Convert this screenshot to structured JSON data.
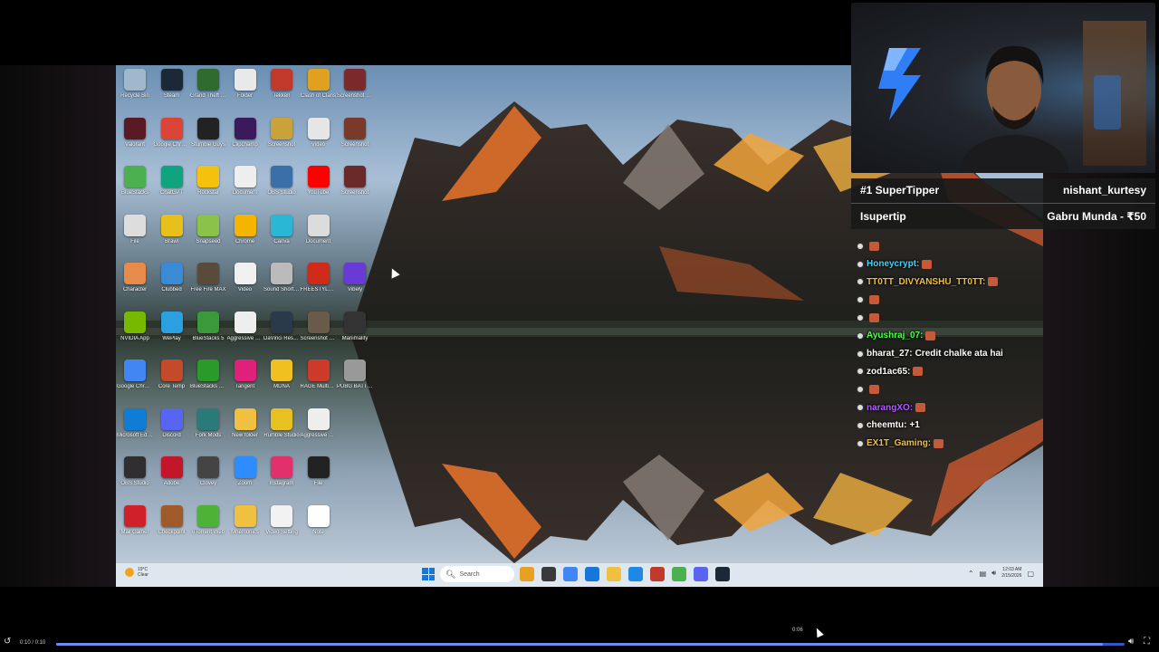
{
  "desktop": {
    "icons": [
      {
        "label": "Recycle Bin",
        "color": "#9fb8cc"
      },
      {
        "label": "Steam",
        "color": "#1b2838"
      },
      {
        "label": "Grand Theft Auto V",
        "color": "#2f6b2f"
      },
      {
        "label": "Folder",
        "color": "#e9e9e9"
      },
      {
        "label": "Tekken",
        "color": "#c0392b"
      },
      {
        "label": "Clash of Clans",
        "color": "#e0a020"
      },
      {
        "label": "Screenshot 2025",
        "color": "#7a2a2a"
      },
      {
        "label": "Valorant",
        "color": "#5a1a24"
      },
      {
        "label": "Google Chrome",
        "color": "#db4437"
      },
      {
        "label": "Stumble Guys",
        "color": "#222222"
      },
      {
        "label": "Clipchamp",
        "color": "#3a1a5a"
      },
      {
        "label": "Screenshot",
        "color": "#c9a23a"
      },
      {
        "label": "Video",
        "color": "#e6e6e6"
      },
      {
        "label": "Screenshot",
        "color": "#7a3a2a"
      },
      {
        "label": "BlueStacks",
        "color": "#4caf50"
      },
      {
        "label": "ChatGPT",
        "color": "#10a37f"
      },
      {
        "label": "Rockstar",
        "color": "#f4c20d"
      },
      {
        "label": "Document",
        "color": "#eeeeee"
      },
      {
        "label": "OBS Studio",
        "color": "#3b6fa8"
      },
      {
        "label": "YouTube",
        "color": "#ff0000"
      },
      {
        "label": "Screenshot",
        "color": "#6a2a2a"
      },
      {
        "label": "File",
        "color": "#dddddd"
      },
      {
        "label": "Brawl",
        "color": "#e8c01a"
      },
      {
        "label": "Snapseed",
        "color": "#8bc34a"
      },
      {
        "label": "Chrome",
        "color": "#f4b400"
      },
      {
        "label": "Canva",
        "color": "#2ab7d6"
      },
      {
        "label": "Document",
        "color": "#dcdcdc"
      },
      {
        "label": "Character",
        "color": "#e88a4a"
      },
      {
        "label": "Clubbed",
        "color": "#3a8ad6"
      },
      {
        "label": "Free Fire MAX",
        "color": "#5a4a3a"
      },
      {
        "label": "Video",
        "color": "#f0f0f0"
      },
      {
        "label": "Sound Shortcut",
        "color": "#bbbbbb"
      },
      {
        "label": "FREESTYLE TYPE BEAT",
        "color": "#d02a1a"
      },
      {
        "label": "Vibely",
        "color": "#6a3ad6"
      },
      {
        "label": "NVIDIA App",
        "color": "#76b900"
      },
      {
        "label": "WePlay",
        "color": "#2aa0e0"
      },
      {
        "label": "BlueStacks 5",
        "color": "#3a9a3a"
      },
      {
        "label": "Aggressive Pan Flow",
        "color": "#eeeeee"
      },
      {
        "label": "DaVinci Resolve",
        "color": "#2a3a4a"
      },
      {
        "label": "Screenshot 2025-11",
        "color": "#6a5a4a"
      },
      {
        "label": "Manimality",
        "color": "#333333"
      },
      {
        "label": "Google Chrome",
        "color": "#4285f4"
      },
      {
        "label": "Core Temp",
        "color": "#c44a2a"
      },
      {
        "label": "BlueStacks Multi-Instance",
        "color": "#2a9a2a"
      },
      {
        "label": "Tangent",
        "color": "#e0207a"
      },
      {
        "label": "MDNA",
        "color": "#f0c020"
      },
      {
        "label": "RAGE Multiplayer",
        "color": "#cc3a2a"
      },
      {
        "label": "PUBG BATTLEGR",
        "color": "#999999"
      },
      {
        "label": "Microsoft Edge",
        "color": "#0f7dd6"
      },
      {
        "label": "Discord",
        "color": "#5865f2"
      },
      {
        "label": "Fork Mods",
        "color": "#2a7a7a"
      },
      {
        "label": "New folder",
        "color": "#f0c040"
      },
      {
        "label": "Rumble Studio",
        "color": "#e8c020"
      },
      {
        "label": "Aggressive Pan Flow",
        "color": "#eeeeee"
      },
      {
        "label": "OBS Studio",
        "color": "#302e31"
      },
      {
        "label": "Adobe",
        "color": "#c4162a"
      },
      {
        "label": "Clovey",
        "color": "#444444"
      },
      {
        "label": "Zoom",
        "color": "#2d8cff"
      },
      {
        "label": "Instagram",
        "color": "#e1306c"
      },
      {
        "label": "File",
        "color": "#222222"
      },
      {
        "label": "Mail Gamer",
        "color": "#d0202a"
      },
      {
        "label": "Checkpoint",
        "color": "#a05a2a"
      },
      {
        "label": "uTorrent Web",
        "color": "#4cb336"
      },
      {
        "label": "Mnemonics",
        "color": "#f0c040"
      },
      {
        "label": "Video Setting",
        "color": "#f2f2f2"
      },
      {
        "label": "Note",
        "color": "#ffffff"
      }
    ]
  },
  "taskbar": {
    "weather_temp": "19°C",
    "weather_desc": "Clear",
    "search_placeholder": "Search",
    "apps": [
      "#e8a020",
      "#3a3a3a",
      "#4285f4",
      "#1577d9",
      "#f0c040",
      "#1e88e5",
      "#c0392b",
      "#4caf50",
      "#5865f2",
      "#1b2838"
    ],
    "time": "12:03 AM",
    "date": "2/15/2026"
  },
  "webcam": {
    "logo_color": "#2f7df7"
  },
  "tipper": {
    "label_1": "#1 SuperTipper",
    "value_1": "nishant_kurtesy",
    "label_2": "Isupertip",
    "value_2": "Gabru Munda - ₹50"
  },
  "chat": [
    {
      "user": "",
      "text": "",
      "color": "#e03030"
    },
    {
      "user": "Honeycrypt:",
      "text": "",
      "color": "#38d7ff"
    },
    {
      "user": "TT0TT_DIVYANSHU_TT0TT:",
      "text": "",
      "color": "#f0c040"
    },
    {
      "user": "",
      "text": "",
      "color": "#e03030"
    },
    {
      "user": "",
      "text": "",
      "color": "#e03030"
    },
    {
      "user": "Ayushraj_07:",
      "text": "",
      "color": "#4cff4c"
    },
    {
      "user": "bharat_27:",
      "text": "Credit chalke ata hai",
      "color": "#ffffff"
    },
    {
      "user": "zod1ac65:",
      "text": "",
      "color": "#ffffff"
    },
    {
      "user": "",
      "text": "",
      "color": "#e03030"
    },
    {
      "user": "narangXO:",
      "text": "",
      "color": "#b05aff"
    },
    {
      "user": "cheemtu:",
      "text": "+1",
      "color": "#ffffff"
    },
    {
      "user": "EX1T_Gaming:",
      "text": "",
      "color": "#f0c040"
    }
  ],
  "player": {
    "time_display": "0:10 / 0:10",
    "hover_time": "0:06",
    "progress": 0.98
  }
}
